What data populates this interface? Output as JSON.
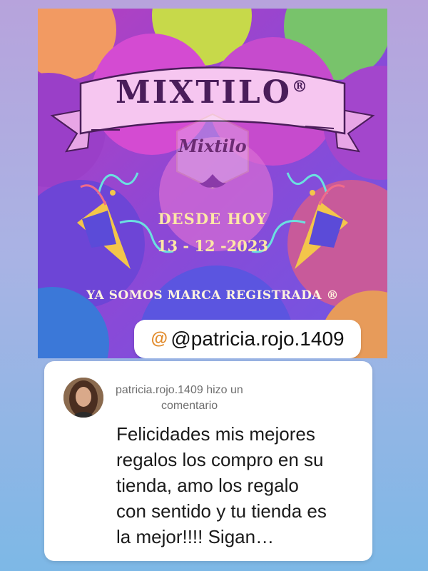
{
  "poster": {
    "brand_title": "MIXTILO",
    "registered_mark": "®",
    "logo_text": "Mixtilo",
    "desde": "DESDE HOY",
    "fecha": "13 - 12 -2023",
    "registrada": "YA SOMOS MARCA REGISTRADA ®"
  },
  "handle_pill": {
    "icon": "threads-icon",
    "handle": "@patricia.rojo.1409",
    "icon_color": "#e28b2b"
  },
  "comment": {
    "header_line1": "patricia.rojo.1409 hizo un",
    "header_line2": "comentario",
    "body": "Felicidades  mis mejores\nregalos los compro en su\ntienda, amo los regalo\ncon sentido y tu tienda es\nla mejor!!!! Sigan…"
  },
  "colors": {
    "background_top": "#b7a3dc",
    "background_bottom": "#7db8e6",
    "ribbon": "#f6c6f0",
    "title": "#4a1d5a",
    "gold_text": "#fde7a6"
  }
}
